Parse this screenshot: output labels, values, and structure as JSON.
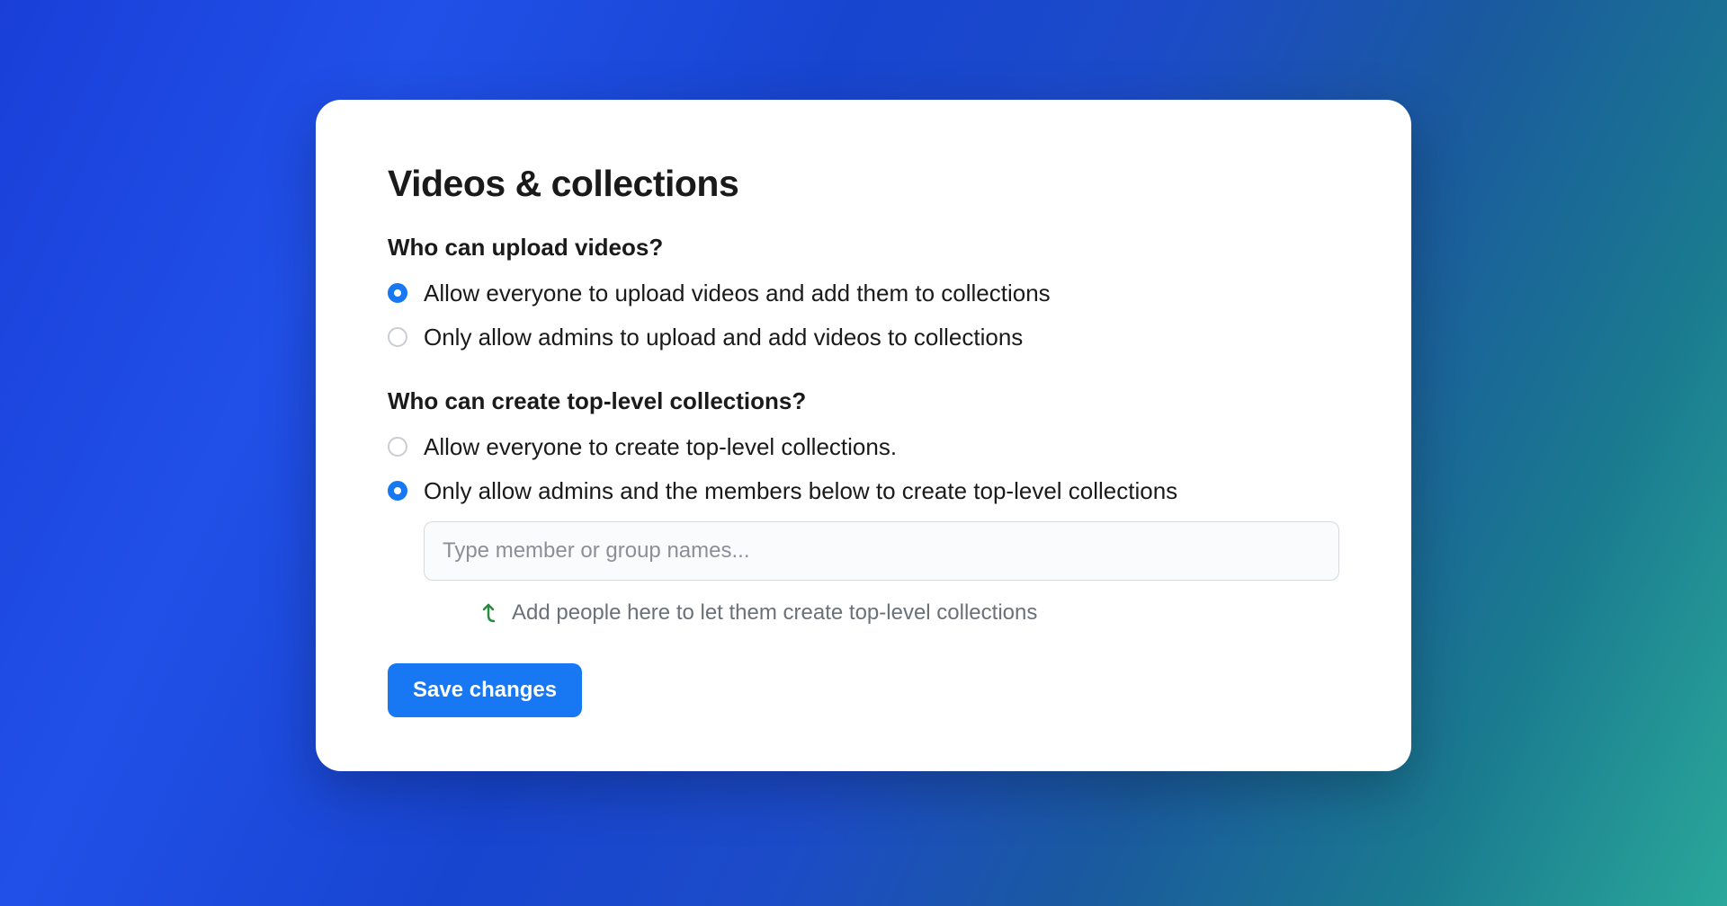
{
  "card": {
    "title": "Videos & collections"
  },
  "upload_section": {
    "title": "Who can upload videos?",
    "options": [
      {
        "label": "Allow everyone to upload videos and add them to collections",
        "selected": true
      },
      {
        "label": "Only allow admins to upload and add videos to collections",
        "selected": false
      }
    ]
  },
  "collections_section": {
    "title": "Who can create top-level collections?",
    "options": [
      {
        "label": "Allow everyone to create top-level collections.",
        "selected": false
      },
      {
        "label": "Only allow admins and the members below to create top-level collections",
        "selected": true
      }
    ],
    "member_input_placeholder": "Type member or group names...",
    "member_input_value": "",
    "help_text": "Add people here to let them create top-level collections"
  },
  "actions": {
    "save_label": "Save changes"
  },
  "colors": {
    "accent": "#1877f2",
    "help_arrow": "#2a8a3f"
  }
}
